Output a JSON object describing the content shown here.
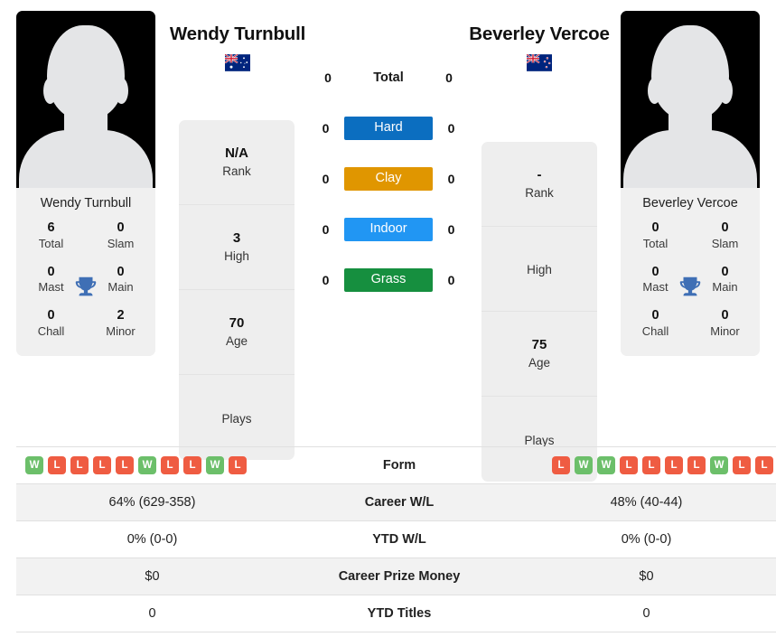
{
  "players": {
    "left": {
      "name": "Wendy Turnbull",
      "card_name": "Wendy Turnbull",
      "country_flag": "australia-flag",
      "photo": "player-photo-placeholder",
      "titles": {
        "total": {
          "value": "6",
          "label": "Total"
        },
        "slam": {
          "value": "0",
          "label": "Slam"
        },
        "mast": {
          "value": "0",
          "label": "Mast"
        },
        "main": {
          "value": "0",
          "label": "Main"
        },
        "chall": {
          "value": "0",
          "label": "Chall"
        },
        "minor": {
          "value": "2",
          "label": "Minor"
        }
      },
      "profile": [
        {
          "value": "N/A",
          "label": "Rank"
        },
        {
          "value": "3",
          "label": "High"
        },
        {
          "value": "70",
          "label": "Age"
        },
        {
          "value": "",
          "label": "Plays"
        }
      ],
      "surface_counts": {
        "total": "0",
        "hard": "0",
        "clay": "0",
        "indoor": "0",
        "grass": "0"
      },
      "form": [
        "W",
        "L",
        "L",
        "L",
        "L",
        "W",
        "L",
        "L",
        "W",
        "L"
      ],
      "career_wl": "64% (629-358)",
      "ytd_wl": "0% (0-0)",
      "career_prize_money": "$0",
      "ytd_titles": "0"
    },
    "right": {
      "name": "Beverley Vercoe",
      "card_name": "Beverley Vercoe",
      "country_flag": "new-zealand-flag",
      "photo": "player-photo-placeholder",
      "titles": {
        "total": {
          "value": "0",
          "label": "Total"
        },
        "slam": {
          "value": "0",
          "label": "Slam"
        },
        "mast": {
          "value": "0",
          "label": "Mast"
        },
        "main": {
          "value": "0",
          "label": "Main"
        },
        "chall": {
          "value": "0",
          "label": "Chall"
        },
        "minor": {
          "value": "0",
          "label": "Minor"
        }
      },
      "profile": [
        {
          "value": "-",
          "label": "Rank"
        },
        {
          "value": "",
          "label": "High"
        },
        {
          "value": "75",
          "label": "Age"
        },
        {
          "value": "",
          "label": "Plays"
        }
      ],
      "surface_counts": {
        "total": "0",
        "hard": "0",
        "clay": "0",
        "indoor": "0",
        "grass": "0"
      },
      "form": [
        "L",
        "W",
        "W",
        "L",
        "L",
        "L",
        "L",
        "W",
        "L",
        "L"
      ],
      "career_wl": "48% (40-44)",
      "ytd_wl": "0% (0-0)",
      "career_prize_money": "$0",
      "ytd_titles": "0"
    }
  },
  "surfaces": [
    {
      "key": "total",
      "label": "Total",
      "color": ""
    },
    {
      "key": "hard",
      "label": "Hard",
      "color": "#0b6ec0"
    },
    {
      "key": "clay",
      "label": "Clay",
      "color": "#e09600"
    },
    {
      "key": "indoor",
      "label": "Indoor",
      "color": "#2196f3"
    },
    {
      "key": "grass",
      "label": "Grass",
      "color": "#168f3f"
    }
  ],
  "table_rows": [
    {
      "label": "Form"
    },
    {
      "label": "Career W/L"
    },
    {
      "label": "YTD W/L"
    },
    {
      "label": "Career Prize Money"
    },
    {
      "label": "YTD Titles"
    }
  ],
  "icons": {
    "trophy": "trophy-icon",
    "trophy_color": "#3f6fb5"
  },
  "colors": {
    "win": "#6cbf6a",
    "loss": "#ef5c42",
    "panel": "#eeeeee",
    "row_shade": "#f2f2f2"
  }
}
